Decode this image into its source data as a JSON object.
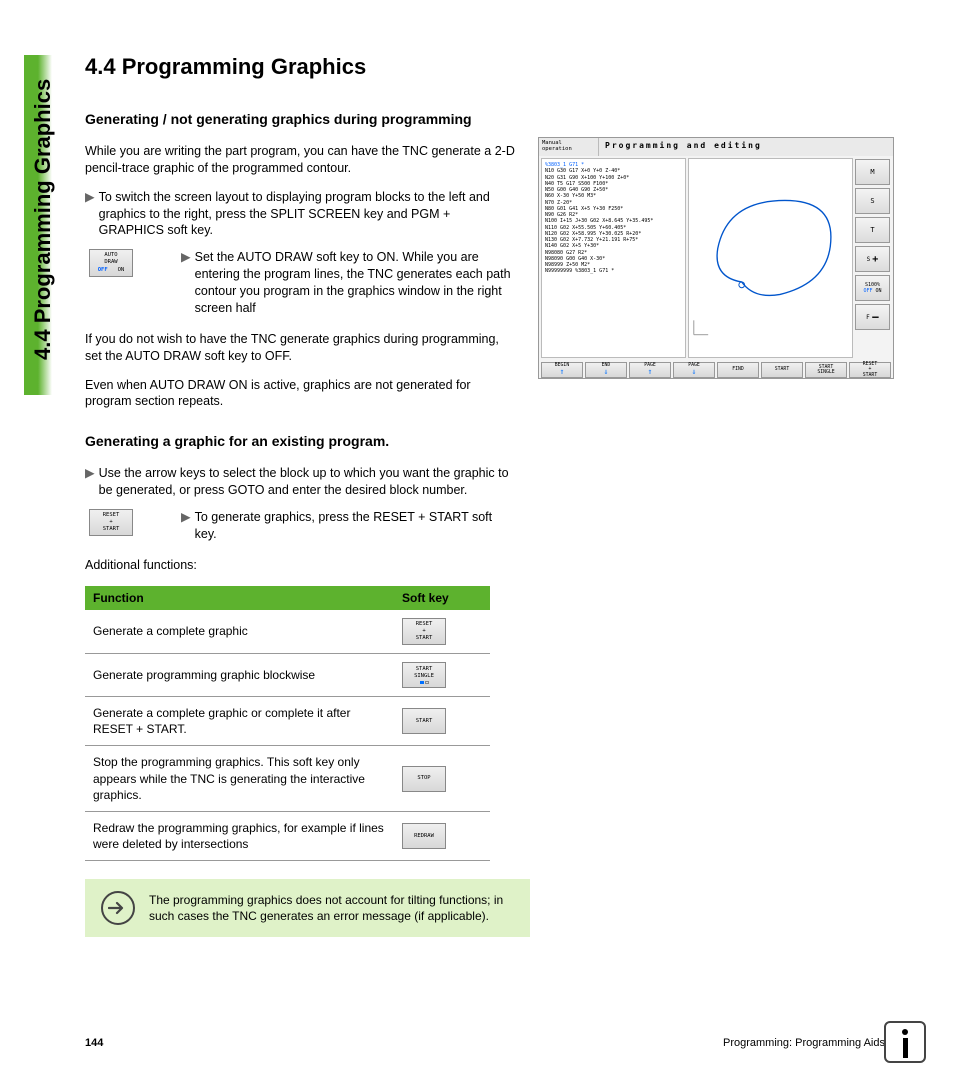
{
  "side_label": "4.4 Programming Graphics",
  "heading": "4.4   Programming Graphics",
  "sec1": {
    "title": "Generating / not generating graphics during programming",
    "p1": "While you are writing the part program, you can have the TNC generate a 2-D pencil-trace graphic of the programmed contour.",
    "b1": "To switch the screen layout to displaying program blocks to the left and graphics to the right, press the SPLIT SCREEN key and PGM + GRAPHICS soft key.",
    "sk1_l1": "AUTO",
    "sk1_l2": "DRAW",
    "sk1_off": "OFF",
    "sk1_on": "ON",
    "b2": "Set the AUTO DRAW soft key to ON. While you are entering the program lines, the TNC generates each path contour you program in the graphics window in the right screen half",
    "p2": "If you do not wish to have the TNC generate graphics during programming, set the AUTO DRAW soft key to OFF.",
    "p3": "Even when AUTO DRAW ON is active, graphics are not generated for program section repeats."
  },
  "sec2": {
    "title": "Generating a graphic for an existing program.",
    "b1": "Use the arrow keys to select the block up to which you want the graphic to be generated, or press GOTO and enter the desired block number.",
    "sk_l1": "RESET",
    "sk_l2": "+",
    "sk_l3": "START",
    "b2": "To generate graphics, press the RESET + START soft key.",
    "add": "Additional functions:"
  },
  "table": {
    "h1": "Function",
    "h2": "Soft key",
    "rows": [
      {
        "f": "Generate a complete graphic",
        "k": [
          "RESET",
          "+",
          "START"
        ]
      },
      {
        "f": "Generate programming graphic blockwise",
        "k": [
          "START",
          "SINGLE"
        ],
        "mini": true
      },
      {
        "f": "Generate a complete graphic or complete it after RESET + START.",
        "k": [
          "START"
        ]
      },
      {
        "f": "Stop the programming graphics. This soft key only appears while the TNC is generating the interactive graphics.",
        "k": [
          "STOP"
        ]
      },
      {
        "f": "Redraw the programming graphics, for example if lines were deleted by intersections",
        "k": [
          "REDRAW"
        ]
      }
    ]
  },
  "note": "The programming graphics does not account for tilting functions; in such cases the TNC generates an error message (if applicable).",
  "footer": {
    "page": "144",
    "chap": "Programming: Programming Aids"
  },
  "screenshot": {
    "mode": "Manual\noperation",
    "title": "Programming and editing",
    "code": "%3803_1 G71 *\nN10 G30 G17 X+0 Y+0 Z-40*\nN20 G31 G90 X+100 Y+100 Z+0*\nN40 T5 G17 S500 F100*\nN50 G00 G40 G90 Z+50*\nN60 X-30 Y+50 M3*\nN70 Z-20*\nN80 G01 G41 X+5 Y+30 F250*\nN90 G26 R2*\nN100 I+15 J+30 G02 X+8.645 Y+35.495*\nN110 G02 X+55.505 Y+60.405*\nN120 G02 X+58.995 Y+30.025 R+20*\nN130 G02 X+7.732 Y+21.191 R+75*\nN140 G02 X+5 Y+30*\nN98080 G27 R2*\nN98090 G00 G40 X-30*\nN98999 Z+50 M2*\nN99999999 %3803_1 G71 *",
    "softkeys": [
      "BEGIN",
      "END",
      "PAGE",
      "PAGE",
      "FIND",
      "START",
      "START\nSINGLE",
      "RESET\n+\nSTART"
    ],
    "side": [
      "M",
      "S",
      "T",
      "S",
      "S100%",
      "F"
    ]
  }
}
